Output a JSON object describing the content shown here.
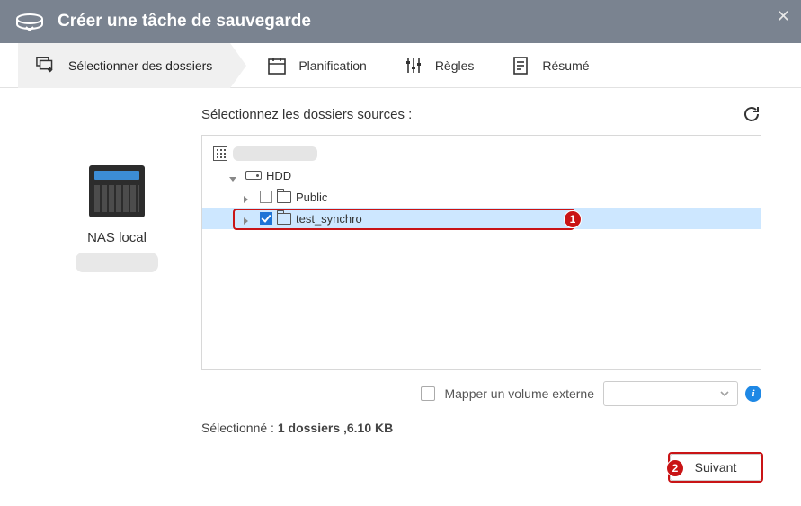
{
  "header": {
    "title": "Créer une tâche de sauvegarde"
  },
  "steps": {
    "select": "Sélectionner des dossiers",
    "schedule": "Planification",
    "rules": "Règles",
    "summary": "Résumé"
  },
  "left": {
    "device_name": "NAS local"
  },
  "main": {
    "title": "Sélectionnez les dossiers sources :",
    "tree": {
      "root_label": "",
      "hdd": "HDD",
      "public": "Public",
      "test_synchro": "test_synchro"
    },
    "map_label": "Mapper un volume externe",
    "selected_prefix": "Sélectionné : ",
    "selected_value": "1 dossiers ,6.10 KB"
  },
  "footer": {
    "next": "Suivant"
  },
  "annot": {
    "one": "1",
    "two": "2"
  }
}
